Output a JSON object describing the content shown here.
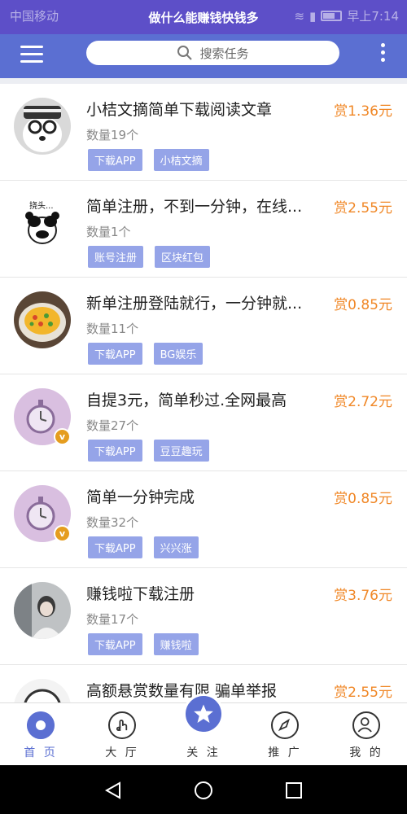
{
  "status": {
    "carrier": "中国移动",
    "title": "做什么能赚钱快钱多",
    "time": "早上7:14"
  },
  "search": {
    "placeholder": "搜索任务"
  },
  "tasks": [
    {
      "title": "小桔文摘简单下载阅读文章",
      "reward": "赏1.36元",
      "count": "数量19个",
      "tags": [
        "下载APP",
        "小桔文摘"
      ],
      "avatar": "dog-glasses"
    },
    {
      "title": "简单注册，不到一分钟，在线...",
      "reward": "赏2.55元",
      "count": "数量1个",
      "tags": [
        "账号注册",
        "区块红包"
      ],
      "avatar": "panda-meme",
      "avatar_text": "挠头..."
    },
    {
      "title": "新单注册登陆就行，一分钟就...",
      "reward": "赏0.85元",
      "count": "数量11个",
      "tags": [
        "下载APP",
        "BG娱乐"
      ],
      "avatar": "food-bowl"
    },
    {
      "title": "自提3元，简单秒过.全网最高",
      "reward": "赏2.72元",
      "count": "数量27个",
      "tags": [
        "下载APP",
        "豆豆趣玩"
      ],
      "avatar": "pocket-watch",
      "badge": "v"
    },
    {
      "title": "简单一分钟完成",
      "reward": "赏0.85元",
      "count": "数量32个",
      "tags": [
        "下载APP",
        "兴兴涨"
      ],
      "avatar": "pocket-watch",
      "badge": "v"
    },
    {
      "title": "赚钱啦下载注册",
      "reward": "赏3.76元",
      "count": "数量17个",
      "tags": [
        "下载APP",
        "赚钱啦"
      ],
      "avatar": "person-photo"
    },
    {
      "title": "高额悬赏数量有限 骗单举报",
      "reward": "赏2.55元",
      "count": "",
      "tags": [],
      "avatar": "cartoon-face"
    }
  ],
  "tabs": [
    {
      "label": "首 页",
      "icon": "home-icon",
      "active": true
    },
    {
      "label": "大 厅",
      "icon": "hand-icon"
    },
    {
      "label": "关 注",
      "icon": "star-icon"
    },
    {
      "label": "推 广",
      "icon": "compass-icon"
    },
    {
      "label": "我 的",
      "icon": "user-icon"
    }
  ],
  "colors": {
    "header": "#5b6fd2",
    "reward": "#f08726",
    "tag": "#95a4e8"
  }
}
